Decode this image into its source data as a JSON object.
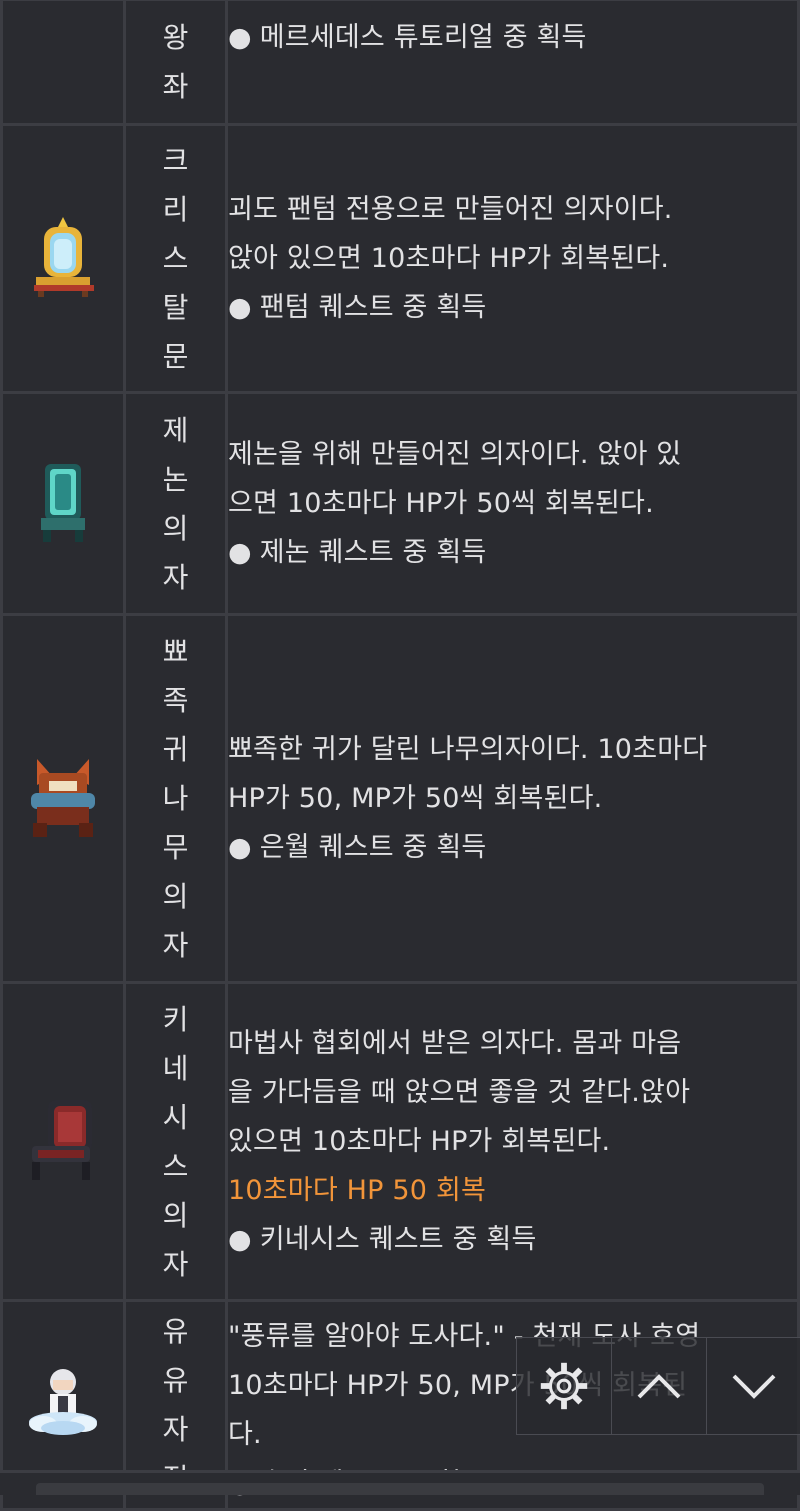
{
  "rows": [
    {
      "name": "왕좌",
      "icon": "throne-icon",
      "desc_lines": [],
      "effect_text": "",
      "source": "메르세데스 튜토리얼 중 획득"
    },
    {
      "name": "크리스탈문",
      "icon": "crystal-moon-chair-icon",
      "desc_lines": [
        "괴도 팬텀 전용으로 만들어진 의자이다.",
        "앉아 있으면 10초마다 HP가 회복된다."
      ],
      "effect_text": "",
      "source": "팬텀 퀘스트 중 획득"
    },
    {
      "name": "제논의자",
      "icon": "xenon-chair-icon",
      "desc_lines": [
        "제논을 위해 만들어진 의자이다. 앉아 있",
        "으면 10초마다 HP가 50씩 회복된다."
      ],
      "effect_text": "",
      "source": "제논 퀘스트 중 획득"
    },
    {
      "name": "뾰족귀나무의자",
      "icon": "pointy-ear-wood-chair-icon",
      "desc_lines": [
        "뾰족한 귀가 달린 나무의자이다. 10초마다",
        "HP가 50, MP가 50씩 회복된다."
      ],
      "effect_text": "",
      "source": "은월 퀘스트 중 획득"
    },
    {
      "name": "키네시스의자",
      "icon": "kinesis-chair-icon",
      "desc_lines": [
        "마법사 협회에서 받은 의자다. 몸과 마음",
        "을 가다듬을 때 앉으면 좋을 것 같다.앉아",
        "있으면 10초마다 HP가 회복된다."
      ],
      "effect_text": "10초마다 HP 50 회복",
      "source": "키네시스 퀘스트 중 획득"
    },
    {
      "name": "유유자적",
      "icon": "leisure-cloud-chair-icon",
      "desc_lines": [
        "\"풍류를 알아야 도사다.\" - 천재 도사 호영",
        "10초마다 HP가 50, MP가 50씩 회복된",
        "다."
      ],
      "effect_text": "",
      "source": "호영 퀘스트 중 획득"
    }
  ],
  "bullet": "●",
  "colors": {
    "background": "#2a2b30",
    "border": "#3c3d43",
    "text": "#e2e2e4",
    "effect": "#f2953a"
  },
  "toolbar": {
    "settings_icon": "gear-icon",
    "up_icon": "chevron-up-icon",
    "down_icon": "chevron-down-icon"
  }
}
